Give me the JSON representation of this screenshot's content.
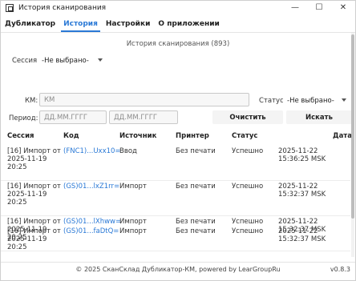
{
  "window": {
    "title": "История сканирования",
    "minimize": "—",
    "maximize": "☐",
    "close": "✕"
  },
  "menu": {
    "tabs": [
      {
        "label": "Дубликатор"
      },
      {
        "label": "История"
      },
      {
        "label": "Настройки"
      },
      {
        "label": "О приложении"
      }
    ],
    "active_tab": "История"
  },
  "history": {
    "title": "История сканирования (893)",
    "session_label": "Сессия:",
    "session_value": "-Не выбрано-",
    "km_label": "КМ:",
    "km_placeholder": "КМ",
    "status_label": "Статус:",
    "status_value": "-Не выбрано-",
    "period_label": "Период:",
    "date_from_placeholder": "ДД.ММ.ГГГГ",
    "date_to_placeholder": "ДД.ММ.ГГГГ",
    "clear_button": "Очистить",
    "search_button": "Искать"
  },
  "table": {
    "columns": [
      "Сессия",
      "Код",
      "Источник",
      "Принтер",
      "Статус",
      "Дата"
    ],
    "rows": [
      {
        "session_1": "[16] Импорт от",
        "session_2": "2025-11-19",
        "session_3": "20:25",
        "code": "(FNC1)...Uxx10=",
        "source": "Ввод",
        "printer": "Без печати",
        "status": "Успешно",
        "date": "2025-11-22 15:36:25 MSK"
      },
      {
        "session_1": "[16] Импорт от",
        "session_2": "2025-11-19",
        "session_3": "20:25",
        "code": "(GS)01...lxZ1rr=",
        "source": "Импорт",
        "printer": "Без печати",
        "status": "Успешно",
        "date": "2025-11-22 15:32:37 MSK"
      },
      {
        "session_1": "[16] Импорт от",
        "session_2": "2025-11-19",
        "session_3": "20:25",
        "code": "(GS)01...lXhww=",
        "source": "Импорт",
        "printer": "Без печати",
        "status": "Успешно",
        "date": "2025-11-22 15:32:37 MSK"
      },
      {
        "session_1": "[16] Импорт от",
        "session_2": "2025-11-19",
        "session_3": "20:25",
        "code": "(GS)01...faDtQ=",
        "source": "Импорт",
        "printer": "Без печати",
        "status": "Успешно",
        "date": "2025-11-22 15:32:37 MSK"
      }
    ]
  },
  "footer": {
    "text": "© 2025 СканСклад Дубликатор-КМ, powered by LearGroupRu",
    "version": "v0.8.3"
  },
  "colors": {
    "accent": "#2a79d6"
  }
}
